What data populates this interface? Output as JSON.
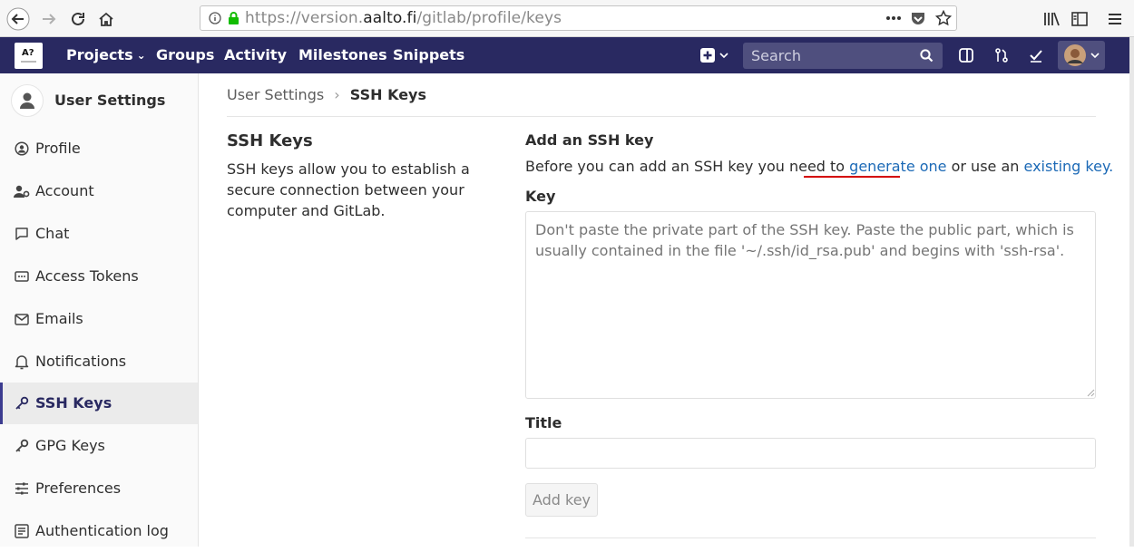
{
  "browser": {
    "url_scheme": "https://version.",
    "url_host": "aalto.fi",
    "url_path": "/gitlab/profile/keys",
    "more_icon": "more-icon",
    "pocket_icon": "pocket-icon",
    "star_icon": "star-icon"
  },
  "nav": {
    "logo_text": "A?",
    "projects": "Projects",
    "groups": "Groups",
    "activity": "Activity",
    "milestones": "Milestones",
    "snippets": "Snippets",
    "search_placeholder": "Search"
  },
  "sidebar": {
    "title": "User Settings",
    "items": [
      {
        "label": "Profile",
        "icon": "profile-icon"
      },
      {
        "label": "Account",
        "icon": "account-icon"
      },
      {
        "label": "Chat",
        "icon": "chat-icon"
      },
      {
        "label": "Access Tokens",
        "icon": "token-icon"
      },
      {
        "label": "Emails",
        "icon": "email-icon"
      },
      {
        "label": "Notifications",
        "icon": "bell-icon"
      },
      {
        "label": "SSH Keys",
        "icon": "key-icon",
        "active": true
      },
      {
        "label": "GPG Keys",
        "icon": "key-icon"
      },
      {
        "label": "Preferences",
        "icon": "sliders-icon"
      },
      {
        "label": "Authentication log",
        "icon": "log-icon"
      }
    ]
  },
  "breadcrumb": {
    "parent": "User Settings",
    "separator": "›",
    "current": "SSH Keys"
  },
  "left": {
    "title": "SSH Keys",
    "description": "SSH keys allow you to establish a secure connection between your computer and GitLab."
  },
  "form": {
    "heading": "Add an SSH key",
    "intro_before": "Before you can add an SSH key you need to ",
    "generate_link": "generate one",
    "intro_middle": " or use an ",
    "existing_link": "existing key.",
    "key_label": "Key",
    "key_placeholder": "Don't paste the private part of the SSH key. Paste the public part, which is usually contained in the file '~/.ssh/id_rsa.pub' and begins with 'ssh-rsa'.",
    "title_label": "Title",
    "title_value": "",
    "add_button": "Add key"
  },
  "colors": {
    "nav_bg": "#292961",
    "link": "#1b69b6",
    "annotation_underline": "#d40000"
  }
}
